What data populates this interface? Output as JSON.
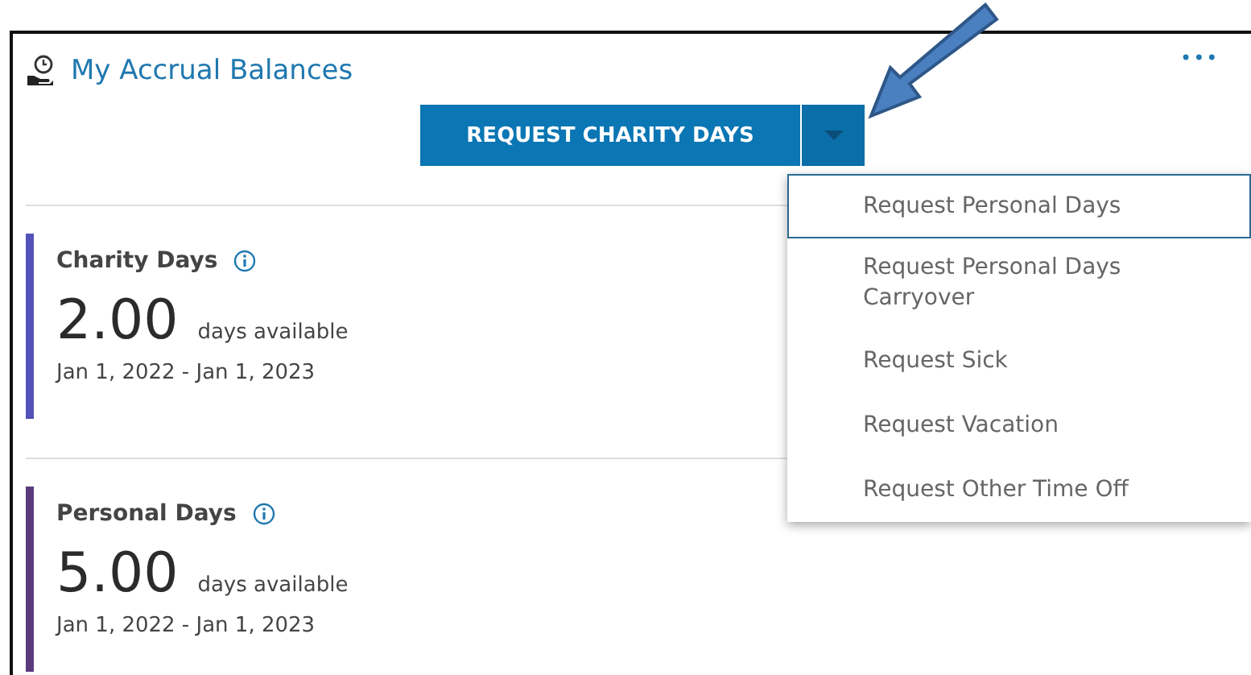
{
  "widget": {
    "title": "My Accrual Balances",
    "more_label": "•••"
  },
  "split_button": {
    "label": "REQUEST CHARITY DAYS",
    "expanded": true
  },
  "menu": [
    {
      "label": "Request Personal Days",
      "selected": true
    },
    {
      "label": "Request Personal Days Carryover",
      "selected": false
    },
    {
      "label": "Request Sick",
      "selected": false
    },
    {
      "label": "Request Vacation",
      "selected": false
    },
    {
      "label": "Request Other Time Off",
      "selected": false
    }
  ],
  "balances": [
    {
      "name": "Charity Days",
      "color": "#5252b8",
      "amount": "2.00",
      "unit": "days available",
      "period": "Jan 1, 2022 - Jan 1, 2023"
    },
    {
      "name": "Personal Days",
      "color": "#5a3c7c",
      "amount": "5.00",
      "unit": "days available",
      "period": "Jan 1, 2022 - Jan 1, 2023"
    }
  ],
  "annotation": {
    "kind": "arrow"
  }
}
